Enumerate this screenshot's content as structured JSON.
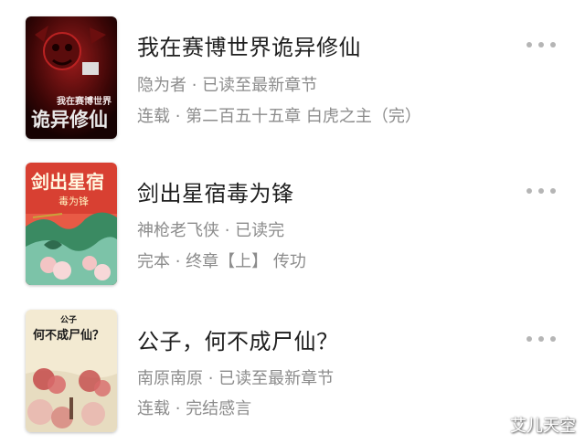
{
  "books": [
    {
      "title": "我在赛博世界诡异修仙",
      "author_progress": "隐为者 · 已读至最新章节",
      "status_chapter": "连载 · 第二百五十五章 白虎之主（完）",
      "cover": {
        "line1": "我在赛博世界",
        "line2": "诡异修仙",
        "colors": [
          "#3a0606",
          "#8a1111",
          "#c8c8c8"
        ]
      }
    },
    {
      "title": "剑出星宿毒为锋",
      "author_progress": "神枪老飞侠 · 已读完",
      "status_chapter": "完本 · 终章【上】 传功",
      "cover": {
        "line1": "剑出星宿",
        "line2": "毒为锋",
        "colors": [
          "#d84032",
          "#3a8a62",
          "#f3c4c4"
        ]
      }
    },
    {
      "title": "公子，何不成尸仙？",
      "author_progress": "南原南原 · 已读至最新章节",
      "status_chapter": "连载 · 完结感言",
      "cover": {
        "line1": "公子",
        "line2": "何不成尸仙？",
        "colors": [
          "#f3ead2",
          "#c44a4a",
          "#e9b8b0"
        ]
      }
    }
  ],
  "watermark": "艾儿天空"
}
